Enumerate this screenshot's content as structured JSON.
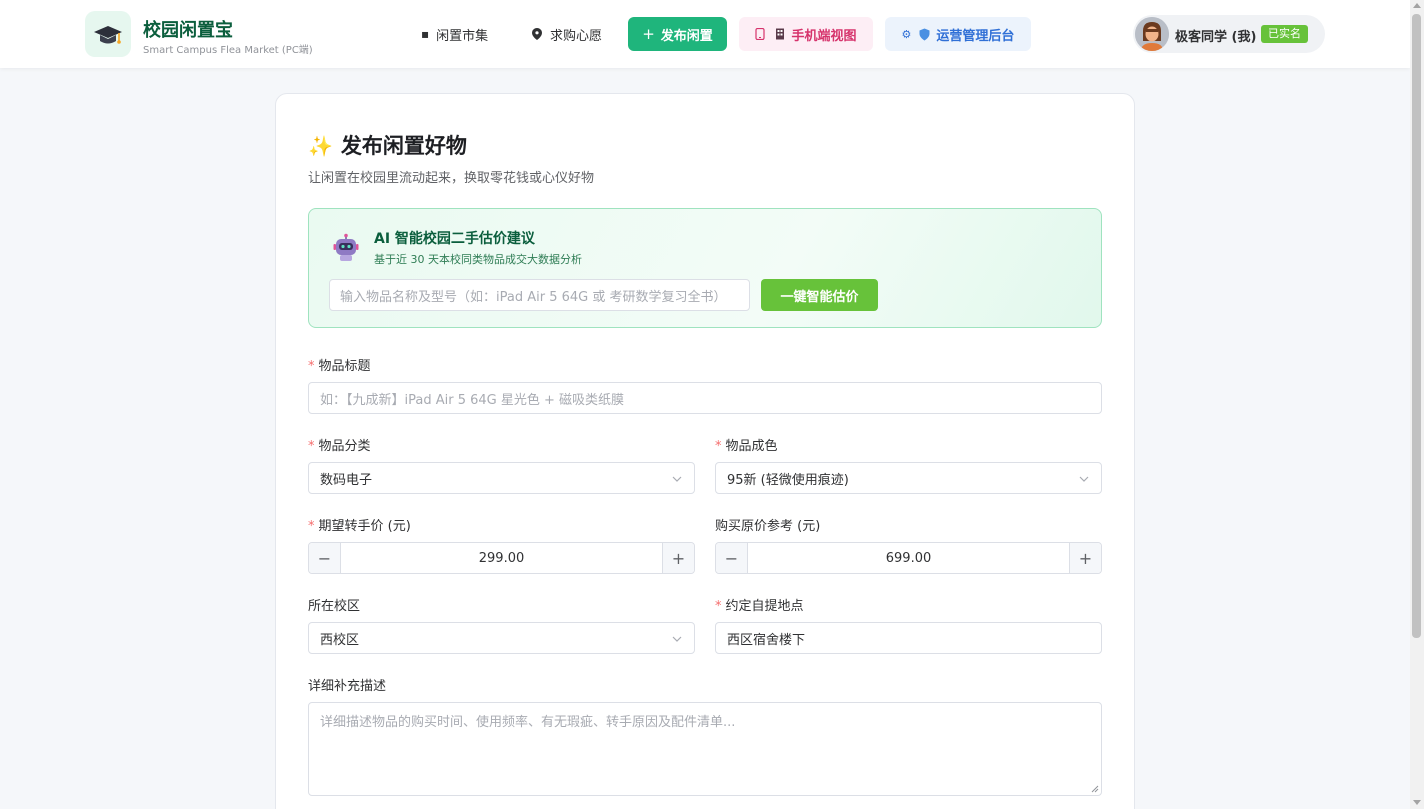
{
  "header": {
    "brand_title": "校园闲置宝",
    "brand_subtitle": "Smart Campus Flea Market (PC端)",
    "logo_icon": "graduation-cap-icon",
    "nav": [
      {
        "label": "闲置市集",
        "icon": "shop-icon"
      },
      {
        "label": "求购心愿",
        "icon": "location-pin-icon"
      }
    ],
    "publish_button": {
      "label": "发布闲置",
      "icon": "plus-icon"
    },
    "mobile_button": {
      "label": "手机端视图",
      "icon": "phone-icon"
    },
    "admin_button": {
      "label": "运营管理后台",
      "icon": "gear-shield-icon"
    },
    "user": {
      "name": "极客同学 (我)",
      "badge": "已实名"
    }
  },
  "form": {
    "title": "发布闲置好物",
    "title_icon": "sparkles-icon",
    "subtitle": "让闲置在校园里流动起来，换取零花钱或心仪好物",
    "ai": {
      "title": "AI 智能校园二手估价建议",
      "subtitle": "基于近 30 天本校同类物品成交大数据分析",
      "input_placeholder": "输入物品名称及型号（如：iPad Air 5 64G 或 考研数学复习全书）",
      "button_label": "一键智能估价",
      "icon": "robot-icon"
    },
    "item_title": {
      "label": "物品标题",
      "placeholder": "如：【九成新】iPad Air 5 64G 星光色 + 磁吸类纸膜"
    },
    "category": {
      "label": "物品分类",
      "value": "数码电子"
    },
    "condition": {
      "label": "物品成色",
      "value": "95新 (轻微使用痕迹)"
    },
    "price": {
      "label": "期望转手价 (元)",
      "value": "299.00"
    },
    "original_price": {
      "label": "购买原价参考 (元)",
      "value": "699.00"
    },
    "campus": {
      "label": "所在校区",
      "value": "西校区"
    },
    "pickup": {
      "label": "约定自提地点",
      "value": "西区宿舍楼下"
    },
    "description": {
      "label": "详细补充描述",
      "placeholder": "详细描述物品的购买时间、使用频率、有无瑕疵、转手原因及配件清单..."
    },
    "required_mark": "*"
  },
  "colors": {
    "brand_green": "#1fb57c",
    "accent_green": "#67c23a",
    "mobile_pink": "#d6336c",
    "admin_blue": "#2f6fd6",
    "required_red": "#f56c6c"
  }
}
